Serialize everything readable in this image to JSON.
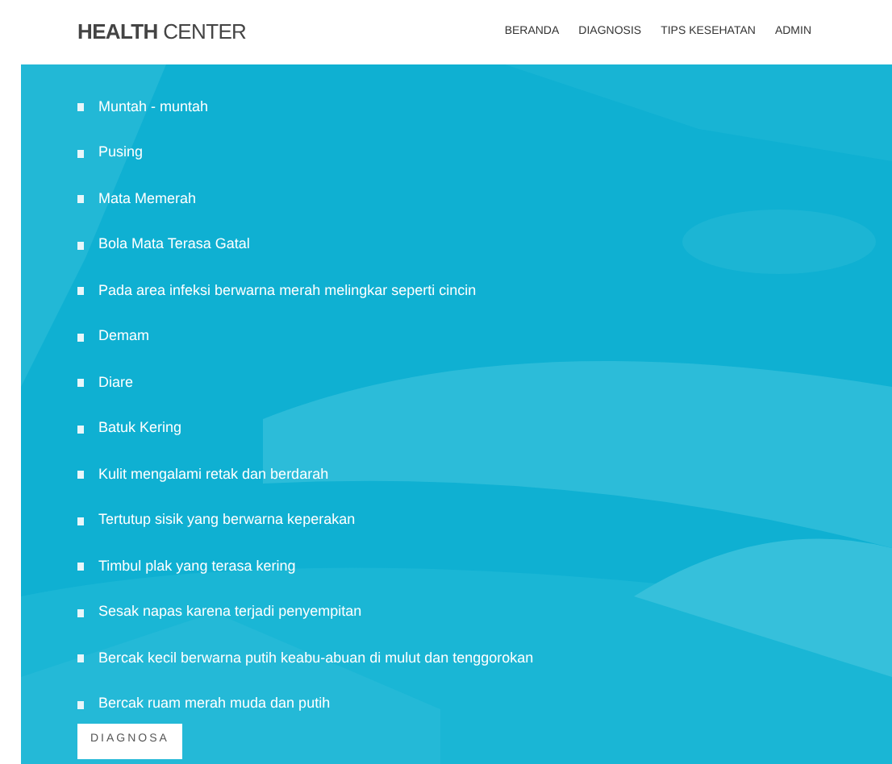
{
  "header": {
    "brand_bold": "HEALTH",
    "brand_rest": "CENTER",
    "nav": [
      {
        "label": "BERANDA"
      },
      {
        "label": "DIAGNOSIS"
      },
      {
        "label": "TIPS KESEHATAN"
      },
      {
        "label": "ADMIN"
      }
    ]
  },
  "symptoms": [
    {
      "label": "Muntah - muntah"
    },
    {
      "label": "Pusing"
    },
    {
      "label": "Mata Memerah"
    },
    {
      "label": "Bola Mata Terasa Gatal"
    },
    {
      "label": "Pada area infeksi berwarna merah melingkar seperti cincin"
    },
    {
      "label": "Demam"
    },
    {
      "label": "Diare"
    },
    {
      "label": "Batuk Kering"
    },
    {
      "label": "Kulit mengalami retak dan berdarah"
    },
    {
      "label": "Tertutup sisik yang berwarna keperakan"
    },
    {
      "label": "Timbul plak yang terasa kering"
    },
    {
      "label": "Sesak napas karena terjadi penyempitan"
    },
    {
      "label": "Bercak kecil berwarna putih keabu-abuan di mulut dan tenggorokan"
    },
    {
      "label": "Bercak ruam merah muda dan putih"
    }
  ],
  "submit": {
    "label": "DIAGNOSA"
  }
}
